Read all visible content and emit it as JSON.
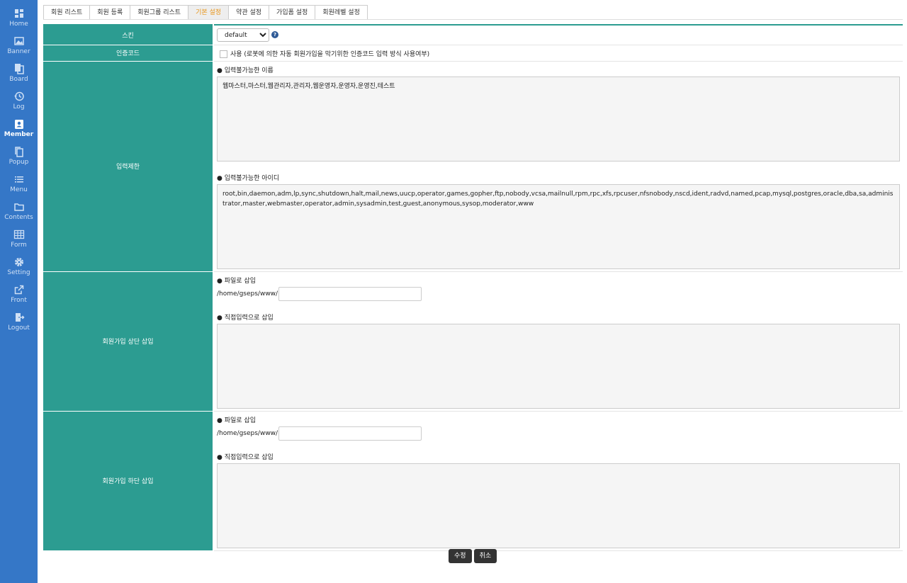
{
  "sidebar": {
    "items": [
      {
        "label": "Home",
        "icon": "dashboard-icon"
      },
      {
        "label": "Banner",
        "icon": "image-icon"
      },
      {
        "label": "Board",
        "icon": "board-icon"
      },
      {
        "label": "Log",
        "icon": "history-icon"
      },
      {
        "label": "Member",
        "icon": "member-badge-icon"
      },
      {
        "label": "Popup",
        "icon": "copy-icon"
      },
      {
        "label": "Menu",
        "icon": "list-icon"
      },
      {
        "label": "Contents",
        "icon": "folder-icon"
      },
      {
        "label": "Form",
        "icon": "table-icon"
      },
      {
        "label": "Setting",
        "icon": "gear-icon"
      },
      {
        "label": "Front",
        "icon": "external-link-icon"
      },
      {
        "label": "Logout",
        "icon": "logout-icon"
      }
    ],
    "active": "Member",
    "bg_color": "#3577c7"
  },
  "tabs": [
    {
      "label": "회원 리스트"
    },
    {
      "label": "회원 등록"
    },
    {
      "label": "회원그룹 리스트"
    },
    {
      "label": "기본 설정"
    },
    {
      "label": "약관 설정"
    },
    {
      "label": "가입폼 설정"
    },
    {
      "label": "회원레벨 설정"
    }
  ],
  "active_tab": "기본 설정",
  "accent_color": "#2c9c91",
  "form": {
    "skin": {
      "label": "스킨",
      "value": "default"
    },
    "auth_code": {
      "label": "인증코드",
      "checkbox_label": "사용 (로봇에 의한 자동 회원가입을 막기위한 인증코드 입력 방식 사용여부)"
    },
    "input_limit": {
      "label": "입력제한",
      "names_label": "● 입력불가능한 이름",
      "names_value": "웹마스터,마스터,웹관리자,관리자,웹운영자,운영자,운영진,테스트",
      "ids_label": "● 입력불가능한 아이디",
      "ids_value": "root,bin,daemon,adm,lp,sync,shutdown,halt,mail,news,uucp,operator,games,gopher,ftp,nobody,vcsa,mailnull,rpm,rpc,xfs,rpcuser,nfsnobody,nscd,ident,radvd,named,pcap,mysql,postgres,oracle,dba,sa,administrator,master,webmaster,operator,admin,sysadmin,test,guest,anonymous,sysop,moderator,www"
    },
    "header_insert": {
      "label": "회원가입 상단 삽입",
      "file_label": "● 파일로 삽입",
      "path_prefix": "/home/gseps/www/",
      "direct_label": "● 직접입력으로 삽입"
    },
    "footer_insert": {
      "label": "회원가입 하단 삽입",
      "file_label": "● 파일로 삽입",
      "path_prefix": "/home/gseps/www/",
      "direct_label": "● 직접입력으로 삽입"
    }
  },
  "buttons": {
    "submit": "수정",
    "cancel": "취소"
  }
}
